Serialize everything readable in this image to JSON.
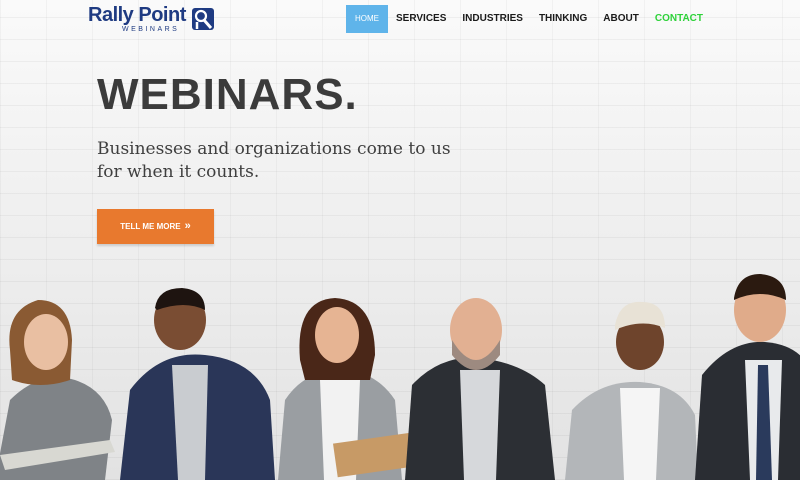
{
  "brand": {
    "name": "Rally Point",
    "tagline": "WEBINARS",
    "colors": {
      "brand_blue": "#1f3b82",
      "nav_active": "#5fb4ea",
      "contact": "#2ed23a",
      "cta": "#e8792e"
    }
  },
  "nav": {
    "items": [
      {
        "label": "HOME",
        "active": true
      },
      {
        "label": "SERVICES"
      },
      {
        "label": "INDUSTRIES"
      },
      {
        "label": "THINKING"
      },
      {
        "label": "ABOUT"
      },
      {
        "label": "CONTACT"
      }
    ]
  },
  "hero": {
    "title": "WEBINARS.",
    "subtitle_line1": "Businesses and organizations come to us",
    "subtitle_line2": "for when it counts.",
    "cta_label": "TELL ME MORE",
    "cta_icon": "double-chevron-right-icon"
  }
}
